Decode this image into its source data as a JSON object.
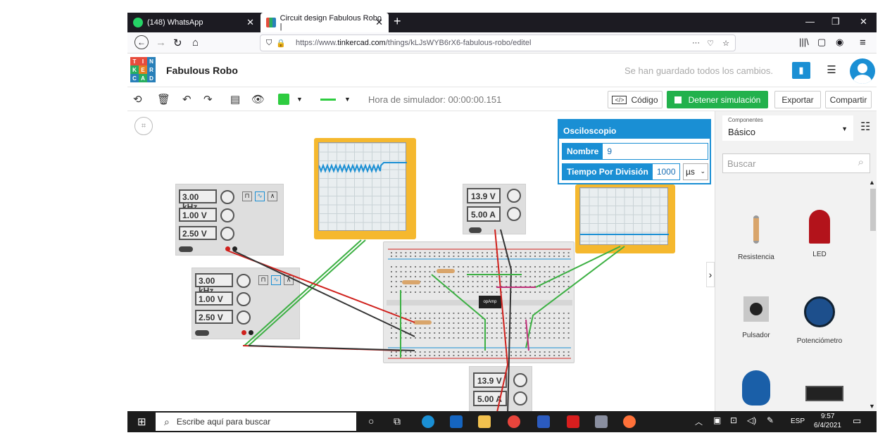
{
  "browser": {
    "tabs": [
      {
        "label": "(148) WhatsApp",
        "icon": "whatsapp-icon"
      },
      {
        "label": "Circuit design Fabulous Robo |",
        "icon": "tinkercad-icon"
      }
    ],
    "url_prefix": "https://www.",
    "url_domain": "tinkercad.com",
    "url_path": "/things/kLJsWYB6rX6-fabulous-robo/editel"
  },
  "header": {
    "logo_letters": [
      "T",
      "I",
      "N",
      "K",
      "E",
      "R",
      "C",
      "A",
      "D"
    ],
    "project_name": "Fabulous Robo",
    "saved_message": "Se han guardado todos los cambios."
  },
  "toolbar": {
    "sim_time": "Hora de simulador: 00:00:00.151",
    "code_label": "Código",
    "stop_label": "Detener simulación",
    "export_label": "Exportar",
    "share_label": "Compartir",
    "color_swatch": "#2ecc40"
  },
  "panel": {
    "category_caption": "Componentes",
    "category_value": "Básico",
    "search_placeholder": "Buscar",
    "components": [
      {
        "label": "Resistencia"
      },
      {
        "label": "LED"
      },
      {
        "label": "Pulsador"
      },
      {
        "label": "Potenciómetro"
      }
    ]
  },
  "scope_popup": {
    "title": "Osciloscopio",
    "name_label": "Nombre",
    "name_value": "9",
    "time_label": "Tiempo Por División",
    "time_value": "1000",
    "time_unit": "µs"
  },
  "instruments": {
    "fgen1": {
      "freq": "3.00 kHz",
      "amp": "1.00 V",
      "offset": "2.50 V"
    },
    "fgen2": {
      "freq": "3.00 kHz",
      "amp": "1.00 V",
      "offset": "2.50 V"
    },
    "psu1": {
      "voltage": "13.9 V",
      "current": "5.00 A"
    },
    "psu2": {
      "voltage": "13.9 V",
      "current": "5.00 A"
    },
    "opamp_label": "opAmp"
  },
  "taskbar": {
    "search_placeholder": "Escribe aquí para buscar",
    "language": "ESP",
    "time": "9:57",
    "date": "6/4/2021"
  },
  "colors": {
    "accent": "#1a8fd4",
    "stop_green": "#22b14c",
    "scope_frame": "#f5b82e",
    "wire_red": "#d0201c",
    "wire_green": "#3cb043",
    "wire_black": "#333333"
  }
}
